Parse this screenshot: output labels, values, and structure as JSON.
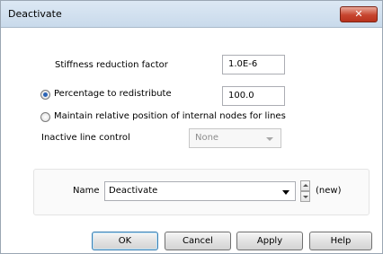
{
  "window": {
    "title": "Deactivate",
    "close_glyph": "✕"
  },
  "form": {
    "stiffness_label": "Stiffness reduction factor",
    "stiffness_value": "1.0E-6",
    "percentage_label": "Percentage to redistribute",
    "percentage_value": "100.0",
    "percentage_selected": true,
    "maintain_label": "Maintain relative position of internal nodes for lines",
    "maintain_selected": false,
    "inactive_line_label": "Inactive line control",
    "inactive_line_value": "None"
  },
  "name_group": {
    "name_label": "Name",
    "name_value": "Deactivate",
    "new_label": "(new)"
  },
  "buttons": {
    "ok": "OK",
    "cancel": "Cancel",
    "apply": "Apply",
    "help": "Help"
  },
  "icons": {
    "close": "close-icon",
    "dropdown": "chevron-down-icon",
    "spin_up": "spin-up-icon",
    "spin_down": "spin-down-icon"
  },
  "colors": {
    "titlebar": "#c9daeb",
    "close_button": "#c7452f",
    "radio_dot": "#2b63b5"
  }
}
